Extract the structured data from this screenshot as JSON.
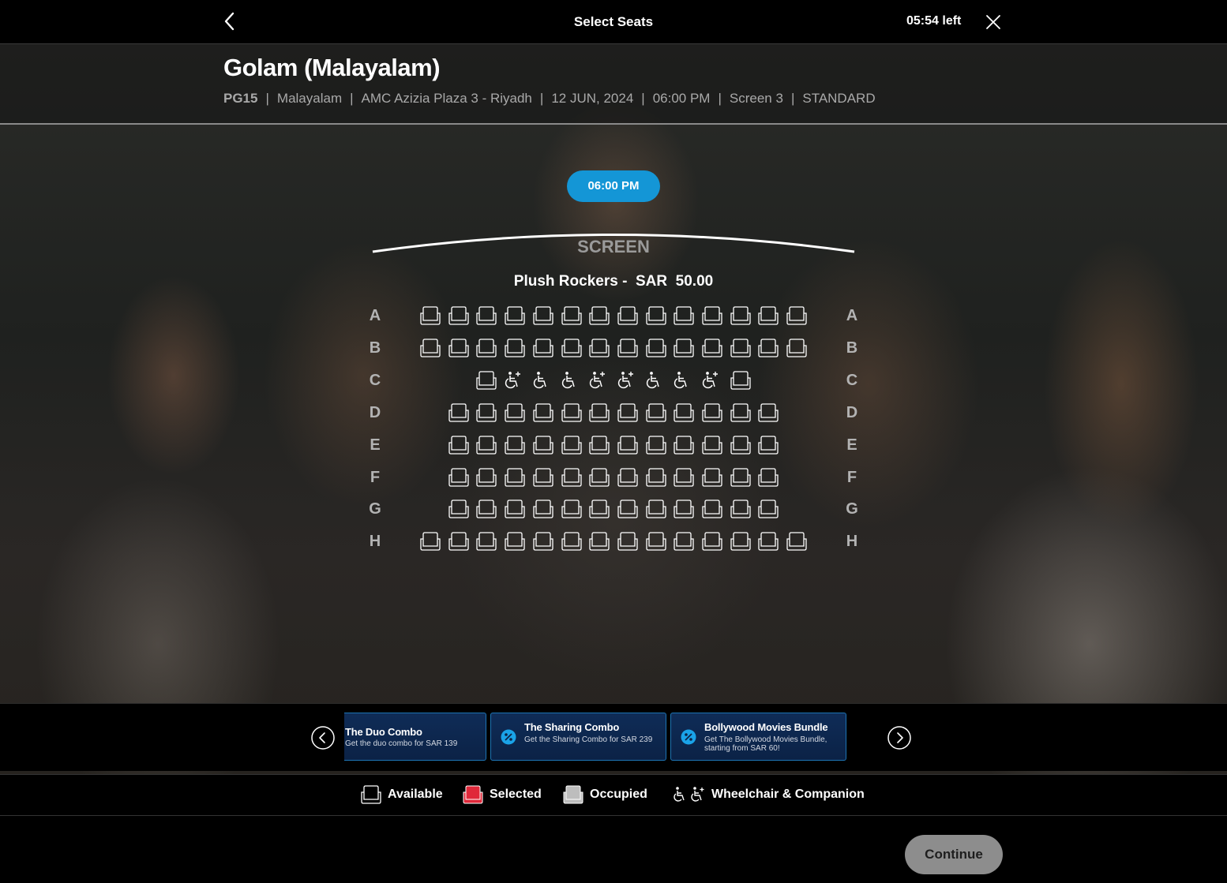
{
  "topbar": {
    "title": "Select Seats",
    "timer": "05:54 left",
    "back_icon": "chevron-left-icon",
    "close_icon": "close-icon"
  },
  "movie": {
    "title": "Golam (Malayalam)",
    "rating": "PG15",
    "language": "Malayalam",
    "cinema": "AMC Azizia Plaza 3 - Riyadh",
    "date": "12 JUN, 2024",
    "time": "06:00 PM",
    "screen": "Screen 3",
    "format": "STANDARD"
  },
  "showtime": {
    "label": "06:00 PM",
    "color": "#1496d6"
  },
  "screen_label": "SCREEN",
  "seat_class": {
    "name": "Plush Rockers -",
    "currency": "SAR",
    "price": "50.00"
  },
  "rows": [
    {
      "label": "A",
      "seats": [
        "a",
        "a",
        "a",
        "a",
        "a",
        "a",
        "a",
        "a",
        "a",
        "a",
        "a",
        "a",
        "a",
        "a"
      ],
      "offset": 0
    },
    {
      "label": "B",
      "seats": [
        "a",
        "a",
        "a",
        "a",
        "a",
        "a",
        "a",
        "a",
        "a",
        "a",
        "a",
        "a",
        "a",
        "a"
      ],
      "offset": 0
    },
    {
      "label": "C",
      "seats": [
        "a",
        "c",
        "w",
        "w",
        "c",
        "c",
        "w",
        "w",
        "c",
        "a"
      ],
      "offset": 2
    },
    {
      "label": "D",
      "seats": [
        "a",
        "a",
        "a",
        "a",
        "a",
        "a",
        "a",
        "a",
        "a",
        "a",
        "a",
        "a"
      ],
      "offset": 1
    },
    {
      "label": "E",
      "seats": [
        "a",
        "a",
        "a",
        "a",
        "a",
        "a",
        "a",
        "a",
        "a",
        "a",
        "a",
        "a"
      ],
      "offset": 1
    },
    {
      "label": "F",
      "seats": [
        "a",
        "a",
        "a",
        "a",
        "a",
        "a",
        "a",
        "a",
        "a",
        "a",
        "a",
        "a"
      ],
      "offset": 1
    },
    {
      "label": "G",
      "seats": [
        "a",
        "a",
        "a",
        "a",
        "a",
        "a",
        "a",
        "a",
        "a",
        "a",
        "a",
        "a"
      ],
      "offset": 1
    },
    {
      "label": "H",
      "seats": [
        "a",
        "a",
        "a",
        "a",
        "a",
        "a",
        "a",
        "a",
        "a",
        "a",
        "a",
        "a",
        "a",
        "a"
      ],
      "offset": 0
    }
  ],
  "promos": [
    {
      "title": "The Duo Combo",
      "desc": "Get the duo combo for SAR 139"
    },
    {
      "title": "The Sharing Combo",
      "desc": "Get the Sharing Combo for SAR 239"
    },
    {
      "title": "Bollywood Movies Bundle",
      "desc": "Get The Bollywood Movies Bundle, starting from SAR 60!"
    }
  ],
  "promo_icons": {
    "prev": "chevron-left-circle-icon",
    "next": "chevron-right-circle-icon",
    "discount": "percent-badge-icon"
  },
  "legend": {
    "available": "Available",
    "selected": "Selected",
    "occupied": "Occupied",
    "wheelchair": "Wheelchair & Companion"
  },
  "colors": {
    "selected": "#e0283a",
    "occupied": "#bdbdbd",
    "accent": "#1496d6"
  },
  "continue_label": "Continue"
}
